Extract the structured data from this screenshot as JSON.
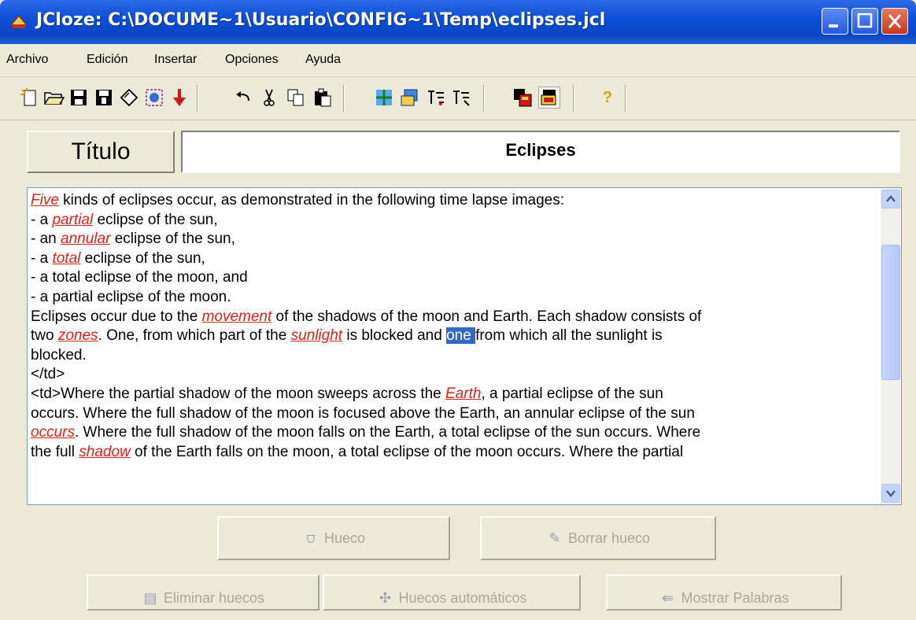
{
  "window": {
    "title": "JCloze: C:\\DOCUME~1\\Usuario\\CONFIG~1\\Temp\\eclipses.jcl"
  },
  "menu": [
    "Archivo",
    "Edición",
    "Insertar",
    "Opciones",
    "Ayuda"
  ],
  "toolbar": {
    "icons": [
      "new-file-icon",
      "open-folder-icon",
      "save-icon",
      "save-as-icon",
      "clear-icon",
      "web-page-icon",
      "export-arrow-icon",
      "undo-icon",
      "cut-icon",
      "copy-icon",
      "paste-icon",
      "gap-settings-icon",
      "add-gap-icon",
      "auto-gaps-icon",
      "show-words-icon",
      "configure-icon",
      "preview-icon",
      "help-icon"
    ]
  },
  "titulo": {
    "label": "Título",
    "value": "Eclipses"
  },
  "text": {
    "l1_gap": "Five",
    "l1": " kinds of eclipses occur, as demonstrated in the following time lapse images:",
    "l2a": "- a ",
    "l2_gap": "partial",
    "l2b": " eclipse of the sun,",
    "l3a": "- an ",
    "l3_gap": "annular",
    "l3b": " eclipse of the sun,",
    "l4a": "- a ",
    "l4_gap": "total",
    "l4b": " eclipse of the sun,",
    "l5": "- a total eclipse of the moon, and",
    "l6": "- a partial eclipse of the moon.",
    "l7a": "Eclipses occur due to the ",
    "l7_gap": "movement",
    "l7b": " of the shadows of the moon and Earth. Each shadow consists of",
    "l8a": "two ",
    "l8_gap": "zones",
    "l8b": ". One, from which part of the ",
    "l8_gap2": "sunlight",
    "l8c": " is blocked and ",
    "l8_sel": "one ",
    "l8d": "from which all the sunlight is",
    "l9": "blocked.",
    "l10": "</td>",
    "l11a": "<td>Where the partial shadow of the moon sweeps across the ",
    "l11_gap": "Earth",
    "l11b": ", a partial eclipse of the sun",
    "l12": "occurs. Where the full shadow of the moon is focused above the Earth, an annular eclipse of the sun",
    "l13_gap": "occurs",
    "l13": ". Where the full shadow of the moon falls on the Earth, a total eclipse of the sun occurs. Where",
    "l14a": "the full ",
    "l14_gap": "shadow",
    "l14b": " of the Earth falls on the moon, a total eclipse of the moon occurs. Where the partial"
  },
  "buttons": {
    "hueco": "Hueco",
    "borrar": "Borrar hueco",
    "eliminar": "Eliminar huecos",
    "automaticos": "Huecos automáticos",
    "mostrar": "Mostrar Palabras"
  }
}
